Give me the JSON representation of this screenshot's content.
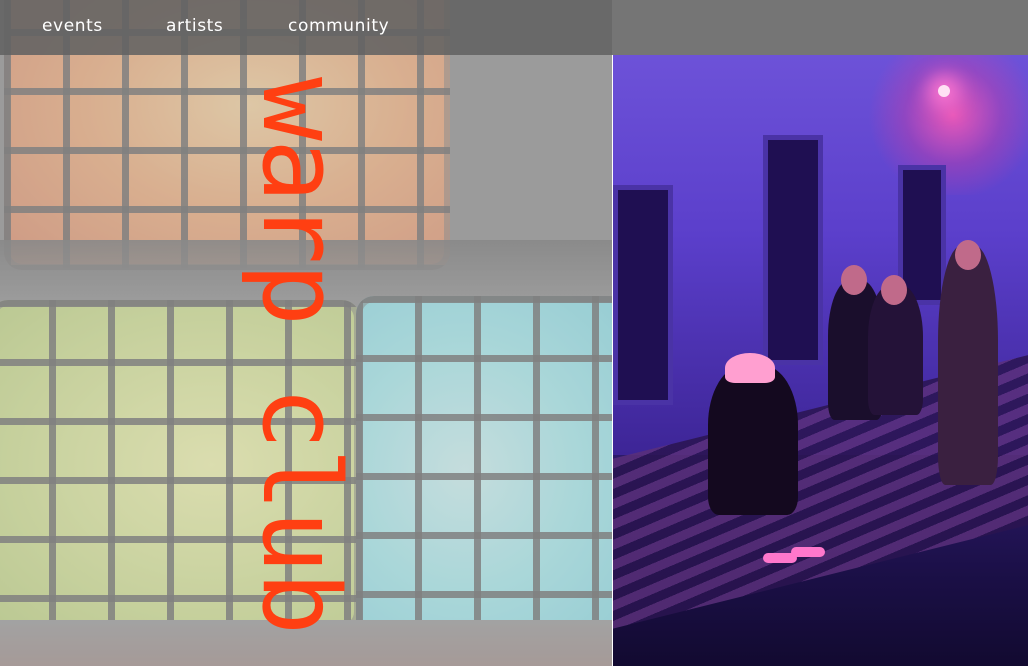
{
  "nav": {
    "items": [
      {
        "label": "events"
      },
      {
        "label": "artists"
      },
      {
        "label": "community"
      }
    ]
  },
  "hero": {
    "title": "warp club",
    "title_color": "#ff3f12",
    "left_image": {
      "description_icon": "glowing-cubes-image"
    },
    "right_image": {
      "description_icon": "crowd-photo-image"
    }
  },
  "colors": {
    "navbar": "#626262",
    "title": "#ff3f12"
  }
}
